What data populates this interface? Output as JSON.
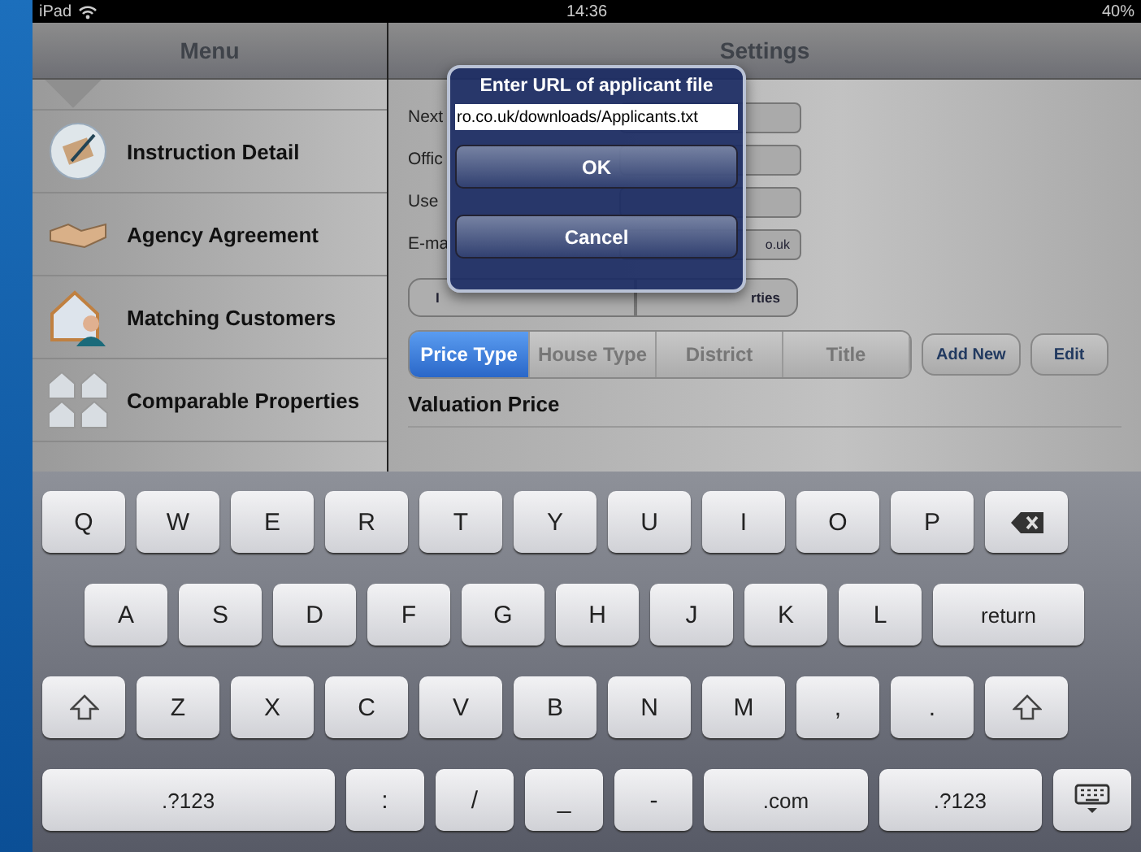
{
  "status_bar": {
    "device": "iPad",
    "time": "14:36",
    "battery": "40%"
  },
  "menu": {
    "title": "Menu",
    "items": [
      {
        "label": "Instruction Detail"
      },
      {
        "label": "Agency Agreement"
      },
      {
        "label": "Matching Customers"
      },
      {
        "label": "Comparable Properties"
      }
    ]
  },
  "settings": {
    "title": "Settings",
    "fields": [
      {
        "label": "Next"
      },
      {
        "label": "Offic"
      },
      {
        "label": "Use"
      },
      {
        "label": "E-ma",
        "value": "o.uk"
      }
    ],
    "import_buttons": [
      "I",
      "rties"
    ],
    "segments": [
      {
        "label": "Price Type",
        "selected": true
      },
      {
        "label": "House Type",
        "selected": false
      },
      {
        "label": "District",
        "selected": false
      },
      {
        "label": "Title",
        "selected": false
      }
    ],
    "actions": [
      "Add New",
      "Edit"
    ],
    "section": "Valuation Price"
  },
  "dialog": {
    "title": "Enter URL of applicant file",
    "value": "ro.co.uk/downloads/Applicants.txt",
    "buttons": [
      "OK",
      "Cancel"
    ]
  },
  "keyboard": {
    "rows": [
      {
        "keys": [
          {
            "kind": "char",
            "label": "Q"
          },
          {
            "kind": "char",
            "label": "W"
          },
          {
            "kind": "char",
            "label": "E"
          },
          {
            "kind": "char",
            "label": "R"
          },
          {
            "kind": "char",
            "label": "T"
          },
          {
            "kind": "char",
            "label": "Y"
          },
          {
            "kind": "char",
            "label": "U"
          },
          {
            "kind": "char",
            "label": "I"
          },
          {
            "kind": "char",
            "label": "O"
          },
          {
            "kind": "char",
            "label": "P"
          },
          {
            "kind": "backspace"
          }
        ]
      },
      {
        "keys": [
          {
            "kind": "char",
            "label": "A"
          },
          {
            "kind": "char",
            "label": "S"
          },
          {
            "kind": "char",
            "label": "D"
          },
          {
            "kind": "char",
            "label": "F"
          },
          {
            "kind": "char",
            "label": "G"
          },
          {
            "kind": "char",
            "label": "H"
          },
          {
            "kind": "char",
            "label": "J"
          },
          {
            "kind": "char",
            "label": "K"
          },
          {
            "kind": "char",
            "label": "L"
          },
          {
            "kind": "wide",
            "label": "return"
          }
        ]
      },
      {
        "keys": [
          {
            "kind": "shift"
          },
          {
            "kind": "char",
            "label": "Z"
          },
          {
            "kind": "char",
            "label": "X"
          },
          {
            "kind": "char",
            "label": "C"
          },
          {
            "kind": "char",
            "label": "V"
          },
          {
            "kind": "char",
            "label": "B"
          },
          {
            "kind": "char",
            "label": "N"
          },
          {
            "kind": "char",
            "label": "M"
          },
          {
            "kind": "char",
            "label": ","
          },
          {
            "kind": "char",
            "label": "."
          },
          {
            "kind": "shift"
          }
        ]
      },
      {
        "keys": [
          {
            "kind": "wide",
            "label": ".?123"
          },
          {
            "kind": "char",
            "label": ":"
          },
          {
            "kind": "char",
            "label": "/"
          },
          {
            "kind": "char",
            "label": "_"
          },
          {
            "kind": "char",
            "label": "-"
          },
          {
            "kind": "wide",
            "label": ".com"
          },
          {
            "kind": "wide",
            "label": ".?123"
          },
          {
            "kind": "hide"
          }
        ]
      }
    ]
  }
}
